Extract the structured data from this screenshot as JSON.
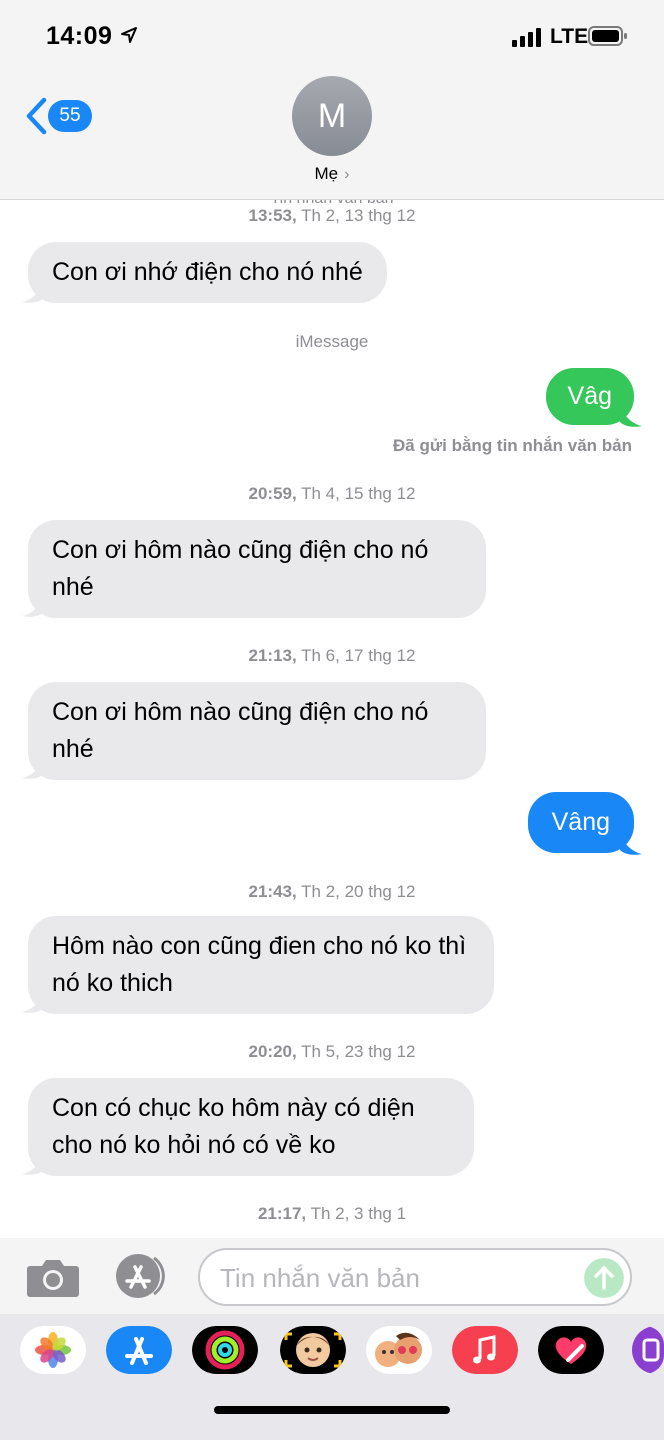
{
  "status_bar": {
    "time": "14:09",
    "network": "LTE"
  },
  "header": {
    "back_badge": "55",
    "avatar_initial": "M",
    "contact_name": "Mẹ"
  },
  "conversation": {
    "cutoff_text": "Tin nhắn văn bản",
    "stamps": [
      {
        "time": "13:53,",
        "date": "Th 2, 13 thg 12"
      },
      {
        "time": "20:59,",
        "date": "Th 4, 15 thg 12"
      },
      {
        "time": "21:13,",
        "date": "Th 6, 17 thg 12"
      },
      {
        "time": "21:43,",
        "date": "Th 2, 20 thg 12"
      },
      {
        "time": "20:20,",
        "date": "Th 5, 23 thg 12"
      },
      {
        "time": "21:17,",
        "date": "Th 2, 3 thg 1"
      }
    ],
    "service_label": "iMessage",
    "delivered_label": "Đã gửi bằng tin nhắn văn bản",
    "messages": [
      {
        "from": "them",
        "text": "Con ơi nhớ điện cho nó nhé"
      },
      {
        "from": "me",
        "service": "sms",
        "text": "Vâg"
      },
      {
        "from": "them",
        "text": "Con ơi hôm nào cũng điện cho nó nhé"
      },
      {
        "from": "them",
        "text": "Con ơi hôm nào cũng điện cho nó nhé"
      },
      {
        "from": "me",
        "service": "imessage",
        "text": "Vâng"
      },
      {
        "from": "them",
        "text": "Hôm nào con cũng đien cho nó ko thì nó ko thich"
      },
      {
        "from": "them",
        "text": "Con có chục ko hôm này có diện cho nó ko hỏi nó có về ko"
      }
    ]
  },
  "input_bar": {
    "placeholder": "Tin nhắn văn bản"
  },
  "drawer": {
    "apps": [
      "photos-icon",
      "app-store-icon",
      "activity-icon",
      "memoji-icon",
      "animoji-stickers-icon",
      "music-icon",
      "digital-touch-icon",
      "more-apps-icon"
    ]
  },
  "colors": {
    "incoming_bubble": "#e9e9eb",
    "sms_bubble": "#35c759",
    "imessage_bubble": "#1a87f7",
    "accent": "#1a87f7"
  }
}
